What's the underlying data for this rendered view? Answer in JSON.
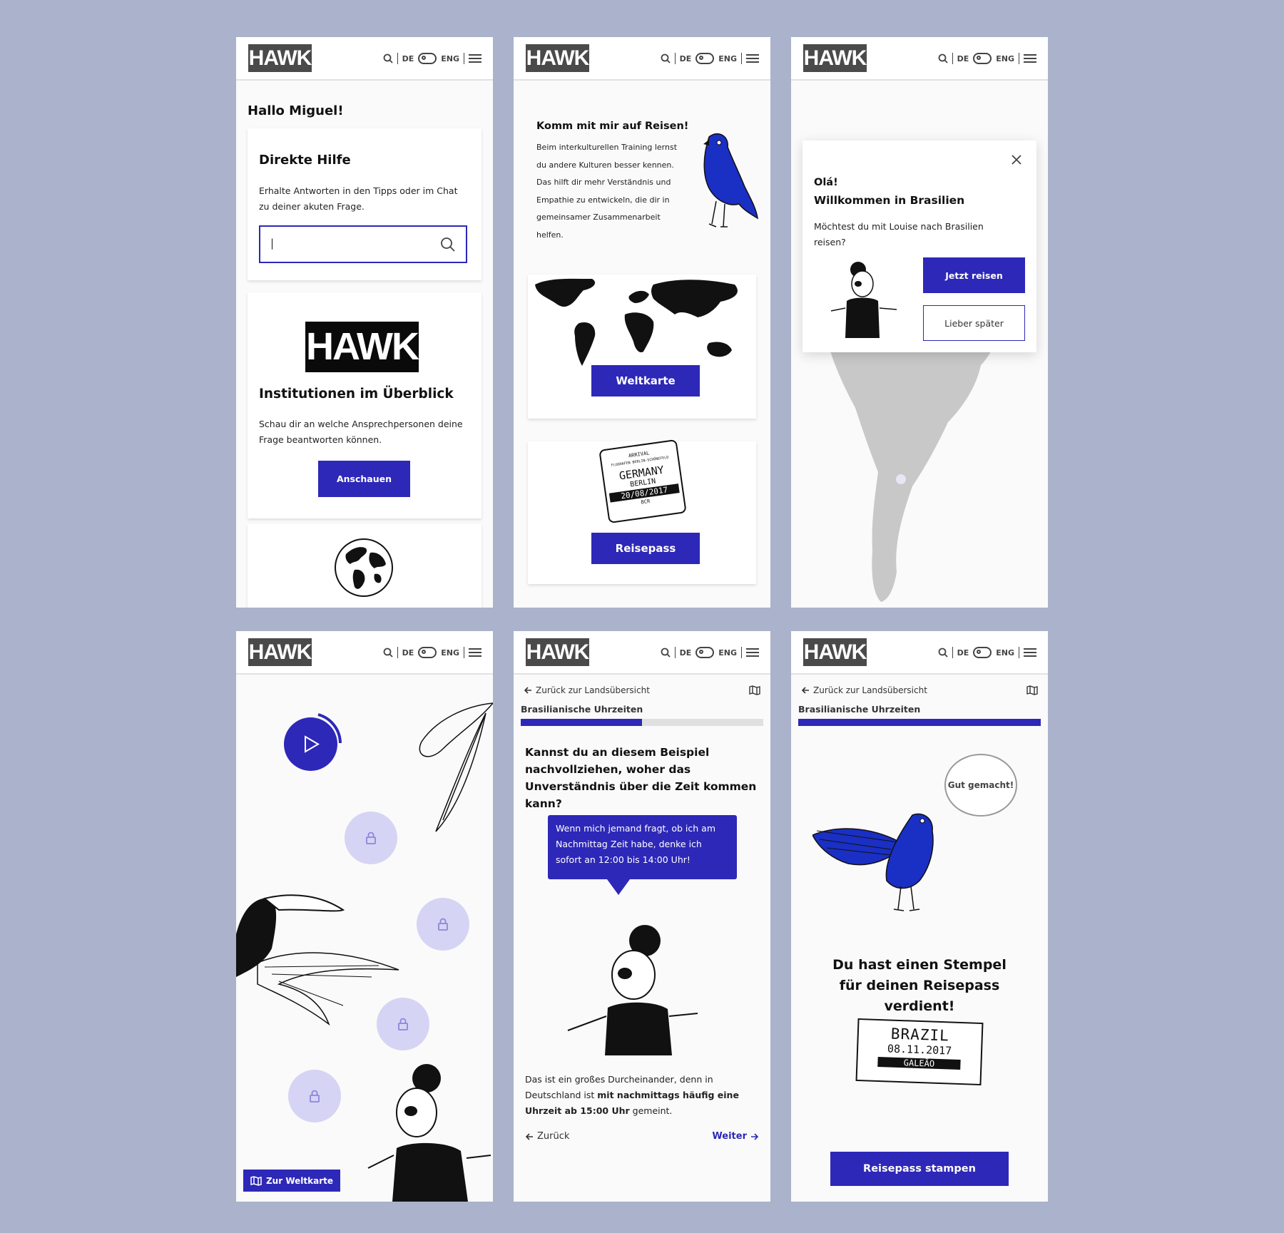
{
  "header": {
    "logo": "HAWK",
    "lang_de": "DE",
    "lang_eng": "ENG"
  },
  "screen1": {
    "greeting": "Hallo Miguel!",
    "help_title": "Direkte Hilfe",
    "help_text": "Erhalte Antworten in den Tipps oder im Chat zu deiner akuten Frage.",
    "search_value": "|",
    "inst_logo": "HAWK",
    "inst_title": "Institutionen im Überblick",
    "inst_text": "Schau dir an welche Ansprechpersonen deine Frage beantworten können.",
    "inst_button": "Anschauen"
  },
  "screen2": {
    "title": "Komm mit mir auf Reisen!",
    "text": "Beim interkulturellen Training lernst du andere Kulturen besser kennen. Das hilft dir mehr Verständnis und Empathie zu entwickeln, die dir in gemeinsamer Zusammenarbeit helfen.",
    "map_button": "Weltkarte",
    "passport_button": "Reisepass",
    "stamp": {
      "top": "ARRIVAL",
      "airport": "FLUGHAFEN BERLIN-SCHÖNEFELD",
      "country": "GERMANY",
      "city": "BERLIN",
      "date": "20/08/2017",
      "code": "BCR"
    }
  },
  "screen3": {
    "greeting": "Olá!",
    "title": "Willkommen in Brasilien",
    "text": "Möchtest du mit Louise nach Brasilien reisen?",
    "primary": "Jetzt reisen",
    "secondary": "Lieber später"
  },
  "screen4": {
    "map_button": "Zur Weltkarte"
  },
  "screen5": {
    "back": "Zurück zur Landsübersicht",
    "section": "Brasilianische Uhrzeiten",
    "progress": 0.5,
    "question": "Kannst du an diesem Beispiel nachvollziehen, woher das Unverständnis über die Zeit kommen kann?",
    "bubble": "Wenn mich jemand fragt, ob ich am Nachmittag Zeit habe, denke ich sofort an 12:00 bis 14:00 Uhr!",
    "body_a": "Das ist ein großes Durcheinander, denn in Deutschland ist ",
    "body_b": "mit nachmittags häufig eine Uhrzeit ab 15:00 Uhr",
    "body_c": " gemeint.",
    "prev": "Zurück",
    "next": "Weiter"
  },
  "screen6": {
    "back": "Zurück zur Landsübersicht",
    "section": "Brasilianische Uhrzeiten",
    "progress": 1.0,
    "speech": "Gut gemacht!",
    "message": "Du hast einen Stempel für deinen Reisepass verdient!",
    "stamp": {
      "country": "BRAZIL",
      "date": "08.11.2017",
      "airport": "GALEÃO"
    },
    "button": "Reisepass stampen"
  },
  "colors": {
    "accent": "#2d28b8",
    "lock": "#d6d4f4",
    "parrot": "#1a2fc4",
    "background": "#aab3cb"
  }
}
